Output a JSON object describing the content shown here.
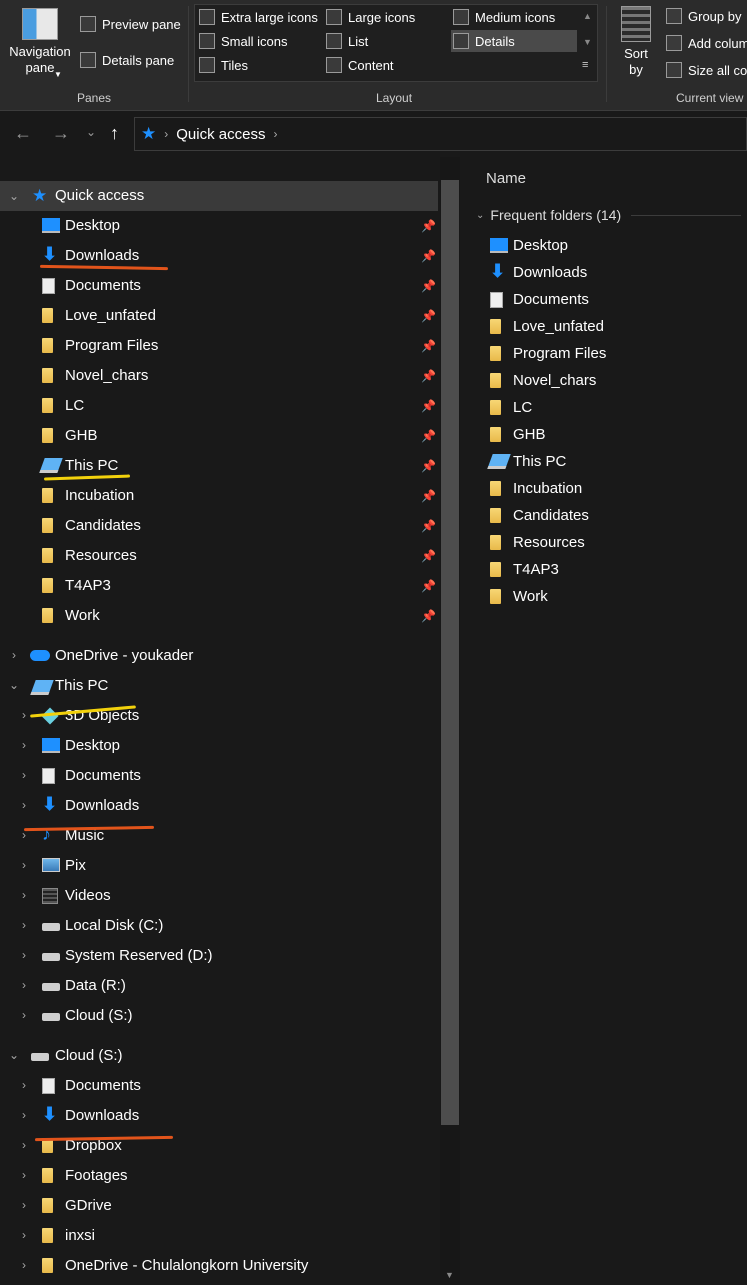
{
  "ribbon": {
    "panes": {
      "navigation_pane": "Navigation pane",
      "preview_pane": "Preview pane",
      "details_pane": "Details pane",
      "group_label": "Panes"
    },
    "layout": {
      "items": [
        "Extra large icons",
        "Large icons",
        "Medium icons",
        "Small icons",
        "List",
        "Details",
        "Tiles",
        "Content"
      ],
      "selected": "Details",
      "group_label": "Layout"
    },
    "current_view": {
      "sort_by": "Sort by",
      "group_by": "Group by",
      "add_columns": "Add colum",
      "size_all": "Size all col",
      "group_label": "Current view"
    }
  },
  "address": {
    "path": [
      "Quick access"
    ]
  },
  "nav": {
    "quick_access": "Quick access",
    "quick_items": [
      "Desktop",
      "Downloads",
      "Documents",
      "Love_unfated",
      "Program Files",
      "Novel_chars",
      "LC",
      "GHB",
      "This PC",
      "Incubation",
      "Candidates",
      "Resources",
      "T4AP3",
      "Work"
    ],
    "onedrive": "OneDrive - youkader",
    "this_pc": "This PC",
    "pc_items": [
      "3D Objects",
      "Desktop",
      "Documents",
      "Downloads",
      "Music",
      "Pix",
      "Videos",
      "Local Disk (C:)",
      "System Reserved (D:)",
      "Data (R:)",
      "Cloud (S:)"
    ],
    "cloud": "Cloud (S:)",
    "cloud_items": [
      "Documents",
      "Downloads",
      "Dropbox",
      "Footages",
      "GDrive",
      "inxsi",
      "OneDrive - Chulalongkorn University"
    ]
  },
  "content": {
    "column_name": "Name",
    "group_header": "Frequent folders (14)",
    "items": [
      "Desktop",
      "Downloads",
      "Documents",
      "Love_unfated",
      "Program Files",
      "Novel_chars",
      "LC",
      "GHB",
      "This PC",
      "Incubation",
      "Candidates",
      "Resources",
      "T4AP3",
      "Work"
    ]
  },
  "colors": {
    "accent_blue": "#1e90ff",
    "folder_yellow": "#f0c75e",
    "annotation_orange": "#e2541b",
    "annotation_yellow": "#f2d10c"
  }
}
